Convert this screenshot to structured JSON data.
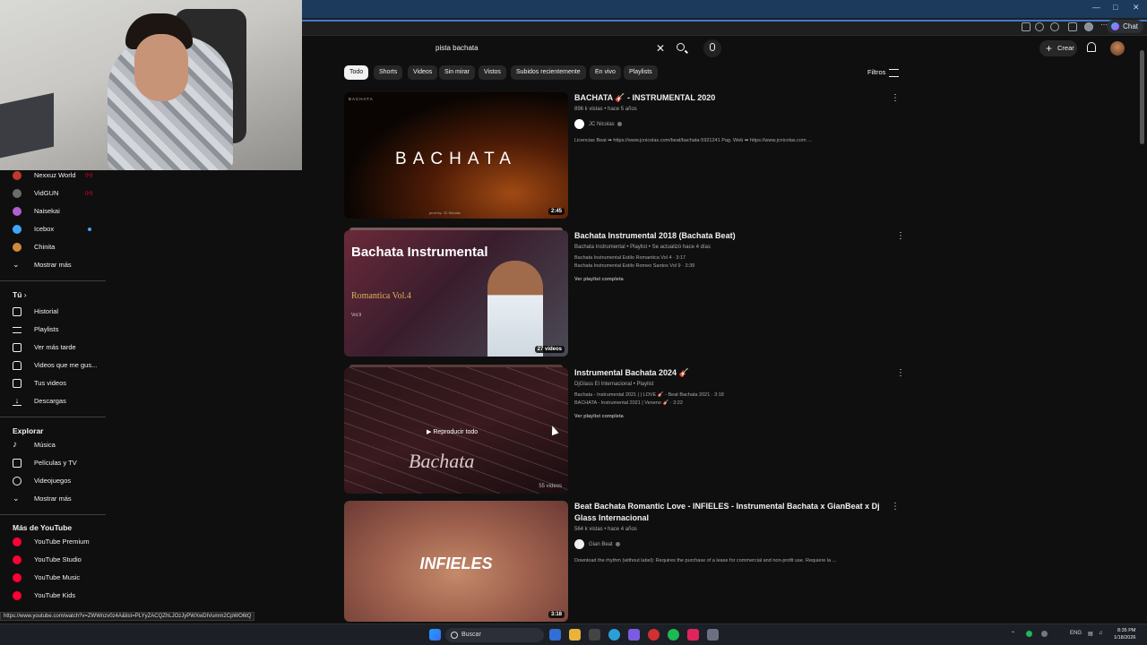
{
  "browser": {
    "window_controls": [
      "—",
      "□",
      "✕"
    ],
    "chat_button": "Chat"
  },
  "search": {
    "query": "pista bachata",
    "clear_icon": "close-icon",
    "search_icon": "search-icon",
    "mic_icon": "mic-icon"
  },
  "header": {
    "create_label": "Crear",
    "bell_icon": "bell-icon"
  },
  "chips": [
    "Todo",
    "Shorts",
    "Videos",
    "Sin mirar",
    "Vistos",
    "Subidos recientemente",
    "En vivo",
    "Playlists"
  ],
  "filters_label": "Filtros",
  "sidebar": {
    "subscriptions": [
      {
        "label": "Nexxuz World",
        "color": "#c0392b",
        "badge": "((•))"
      },
      {
        "label": "VidGUN",
        "color": "#6c6c6c",
        "badge": "((•))"
      },
      {
        "label": "Naisekai",
        "color": "#b05fd0",
        "badge": ""
      },
      {
        "label": "Icebox",
        "color": "#3ea6ff",
        "badge": ""
      },
      {
        "label": "Chinita",
        "color": "#d08a3a",
        "badge": ""
      }
    ],
    "show_more_1": "Mostrar más",
    "you_section": "Tú",
    "you_items": [
      {
        "label": "Historial",
        "icon": "history-icon"
      },
      {
        "label": "Playlists",
        "icon": "playlists-icon"
      },
      {
        "label": "Ver más tarde",
        "icon": "clock-icon"
      },
      {
        "label": "Videos que me gus...",
        "icon": "thumbs-up-icon"
      },
      {
        "label": "Tus videos",
        "icon": "your-videos-icon"
      },
      {
        "label": "Descargas",
        "icon": "download-icon"
      }
    ],
    "explore_section": "Explorar",
    "explore_items": [
      {
        "label": "Música",
        "icon": "music-icon"
      },
      {
        "label": "Películas y TV",
        "icon": "film-icon"
      },
      {
        "label": "Videojuegos",
        "icon": "gamepad-icon"
      }
    ],
    "show_more_2": "Mostrar más",
    "more_youtube_section": "Más de YouTube",
    "more_youtube_items": [
      "YouTube Premium",
      "YouTube Studio",
      "YouTube Music",
      "YouTube Kids"
    ]
  },
  "results": [
    {
      "title": "BACHATA 🎸 - INSTRUMENTAL 2020",
      "meta": "896 k vistas • hace 5 años",
      "channel": "JC Nicolas",
      "description": "Licencias Beat ➡ https://www.jcnicolas.com/beat/bachata-5921241 Pag. Web ➡ https://www.jcnicolas.com ...",
      "duration": "2:45",
      "thumb_text": "BACHATA",
      "thumb_credit": "prod by: JC Nicolas"
    },
    {
      "title": "Bachata Instrumental 2018 (Bachata Beat)",
      "meta": "Bachata Instrumental • Playlist • Se actualizó hace 4 días",
      "lines": [
        "Bachata Instrumental Estilo Romantica Vol 4 · 3:17",
        "Bachata Instrumental Estilo Romeo Santos Vol 9 · 3:39"
      ],
      "see_playlist": "Ver playlist completa",
      "count_badge": "27 videos",
      "thumb_title": "Bachata Instrumental",
      "thumb_sub": "Romantica Vol.4",
      "thumb_vol": "Vol.9"
    },
    {
      "title": "Instrumental Bachata 2024 🎸",
      "meta": "DjGlass El Internacional • Playlist",
      "lines": [
        "Bachata - Instrumental 2021 | | LOVE 🎸 - Beat Bachata 2021 · 3:18",
        "BACHATA - Instrumental 2021 | Veneno 🎸 · 3:22"
      ],
      "see_playlist": "Ver playlist completa",
      "count_badge": "55 videos",
      "play_all": "Reproducir todo",
      "thumb_text": "Bachata"
    },
    {
      "title": "Beat Bachata Romantic Love - INFIELES - Instrumental Bachata x GianBeat x Dj Glass Internacional",
      "meta": "564 k vistas • hace 4 años",
      "channel": "Gian Beat",
      "description": "Download the rhythm (without label): Requires the purchase of a lease for commercial and non-profit use. Requiere la ...",
      "duration": "3:18",
      "thumb_text": "INFIELES"
    }
  ],
  "status_url": "https://www.youtube.com/watch?v=ZWWnzv0z4A&list=PLYyZACQZhLJOzJyPWXwDIVumm2CpWO6tQ",
  "taskbar": {
    "search_label": "Buscar",
    "lang": "ENG",
    "time": "8:35 PM",
    "date": "1/18/2026"
  },
  "colors": {
    "background": "#0f0f0f",
    "chip_active": "#f1f1f1",
    "chip": "#272727",
    "accent_blue": "#3ea6ff",
    "youtube_red": "#ff0033"
  }
}
